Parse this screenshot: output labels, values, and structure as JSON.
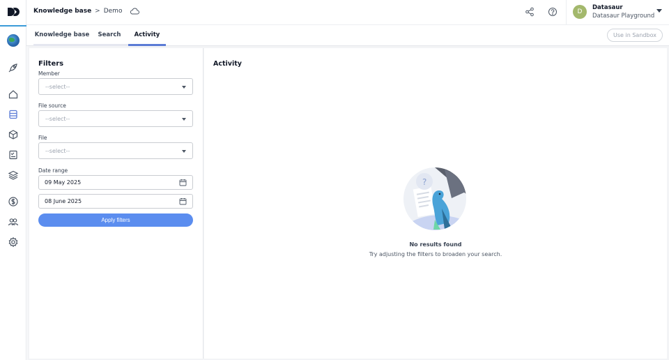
{
  "header": {
    "breadcrumb": {
      "root": "Knowledge base",
      "separator": ">",
      "current": "Demo"
    },
    "user": {
      "initial": "D",
      "name": "Datasaur",
      "org": "Datasaur Playground"
    }
  },
  "tabs": [
    {
      "label": "Knowledge base"
    },
    {
      "label": "Search"
    },
    {
      "label": "Activity",
      "active": true
    }
  ],
  "sandbox_button": "Use in Sandbox",
  "filters": {
    "title": "Filters",
    "member": {
      "label": "Member",
      "placeholder": "--select--"
    },
    "file_source": {
      "label": "File source",
      "placeholder": "--select--"
    },
    "file": {
      "label": "File",
      "placeholder": "--select--"
    },
    "date_range": {
      "label": "Date range",
      "start": "09 May 2025",
      "end": "08 June 2025"
    },
    "apply_label": "Apply filters"
  },
  "activity": {
    "title": "Activity",
    "empty_title": "No results found",
    "empty_subtitle": "Try adjusting the filters to broaden your search."
  },
  "icons": {
    "rail": [
      "globe-avatar",
      "rocket-icon",
      "home-icon",
      "database-icon",
      "cube-icon",
      "checklist-icon",
      "layers-icon",
      "dollar-icon",
      "users-icon",
      "settings-icon"
    ],
    "header": [
      "share-icon",
      "help-icon"
    ]
  },
  "colors": {
    "accent": "#5b8def",
    "active_tab": "#5b7bd5",
    "rail_accent": "#3b9bd8",
    "avatar": "#a3b86c"
  }
}
